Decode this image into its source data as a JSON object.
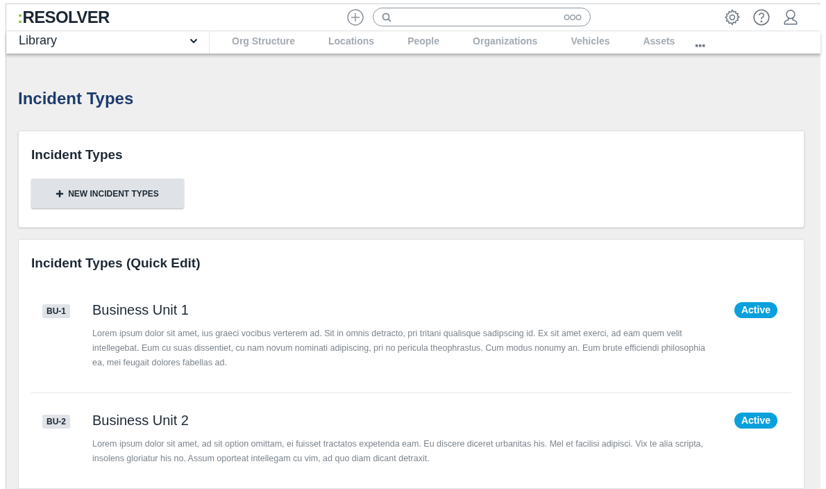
{
  "logo": {
    "mark": ":",
    "name": "RESOLVER"
  },
  "nav": {
    "dropdown": "Library",
    "tabs": [
      {
        "label": "Org Structure",
        "selected": false
      },
      {
        "label": "Locations",
        "selected": false
      },
      {
        "label": "People",
        "selected": false
      },
      {
        "label": "Organizations",
        "selected": false
      },
      {
        "label": "Vehicles",
        "selected": false
      },
      {
        "label": "Assets",
        "selected": false
      }
    ]
  },
  "page_title": "Incident Types",
  "actions_card": {
    "title": "Incident Types",
    "button": "NEW INCIDENT TYPES"
  },
  "list_card": {
    "title": "Incident Types (Quick Edit)",
    "items": [
      {
        "code": "BU-1",
        "name": "Business Unit 1",
        "description": "Lorem ipsum dolor sit amet, ius graeci vocibus verterem ad. Sit in omnis detracto, pri tritani qualisque sadipscing id. Ex sit amet exerci, ad eam quem velit intellegebat. Eum cu suas dissentiet, cu nam novum nominati adipiscing, pri no pericula theophrastus. Cum modus nonumy an. Eum brute efficiendi philosophia ea, mei feugait dolores fabellas ad.",
        "status": "Active"
      },
      {
        "code": "BU-2",
        "name": "Business Unit 2",
        "description": "Lorem ipsum dolor sit amet, ad sit option omittam, ei fuisset tractatos expetenda eam. Eu discere diceret urbanitas his. Mel et facilisi adipisci. Vix te alia scripta, insolens gloriatur his no. Assum oporteat intellegam cu vim, ad quo diam dicant detraxit.",
        "status": "Active"
      }
    ]
  }
}
